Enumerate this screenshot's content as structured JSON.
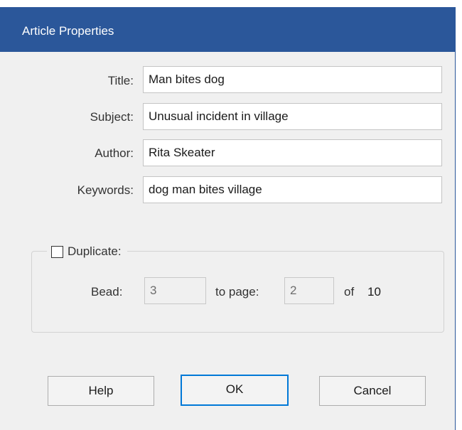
{
  "dialog": {
    "title": "Article Properties"
  },
  "fields": {
    "title": {
      "label": "Title:",
      "value": "Man bites dog"
    },
    "subject": {
      "label": "Subject:",
      "value": "Unusual incident in village"
    },
    "author": {
      "label": "Author:",
      "value": "Rita Skeater"
    },
    "keywords": {
      "label": "Keywords:",
      "value": "dog man bites village"
    }
  },
  "duplicate": {
    "label": "Duplicate:",
    "checked": false,
    "bead_label": "Bead:",
    "bead_value": "3",
    "to_page_label": "to page:",
    "to_page_value": "2",
    "of_label": "of",
    "total_pages": "10"
  },
  "buttons": {
    "help": "Help",
    "ok": "OK",
    "cancel": "Cancel"
  },
  "colors": {
    "titlebar": "#2b579a",
    "dialog_bg": "#f0f0f0",
    "default_button_border": "#0078d7"
  }
}
